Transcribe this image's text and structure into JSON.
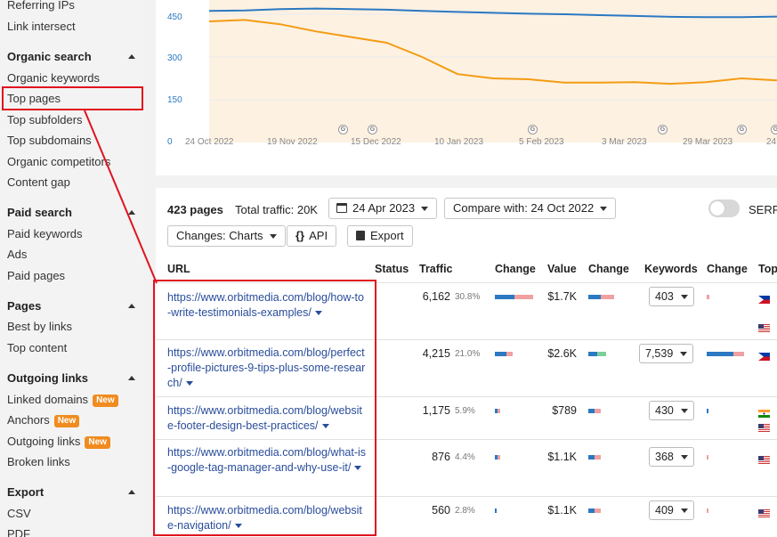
{
  "sidebar": {
    "top_items": [
      "Referring IPs",
      "Link intersect"
    ],
    "sections": [
      {
        "title": "Organic search",
        "items": [
          "Organic keywords",
          "Top pages",
          "Top subfolders",
          "Top subdomains",
          "Organic competitors",
          "Content gap"
        ]
      },
      {
        "title": "Paid search",
        "items": [
          "Paid keywords",
          "Ads",
          "Paid pages"
        ]
      },
      {
        "title": "Pages",
        "items": [
          "Best by links",
          "Top content"
        ]
      },
      {
        "title": "Outgoing links",
        "items": [
          "Linked domains",
          "Anchors",
          "Outgoing links",
          "Broken links"
        ]
      },
      {
        "title": "Export",
        "items": [
          "CSV",
          "PDF"
        ]
      }
    ],
    "new_badge": "New",
    "highlighted": "Top pages"
  },
  "chart": {
    "y_ticks": [
      "450",
      "300",
      "150",
      "0"
    ],
    "x_ticks": [
      "24 Oct 2022",
      "19 Nov 2022",
      "15 Dec 2022",
      "10 Jan 2023",
      "5 Feb 2023",
      "3 Mar 2023",
      "29 Mar 2023",
      "24"
    ],
    "marker_letter": "G",
    "series_colors": {
      "blue": "#2b79c2",
      "orange": "#f39c12",
      "band": "#fdf1e2"
    }
  },
  "chart_data": {
    "type": "line",
    "ylim": [
      0,
      500
    ],
    "series": [
      {
        "color": "#2b79c2",
        "values": [
          462,
          463,
          468,
          470,
          468,
          466,
          462,
          458,
          455,
          452,
          450,
          447,
          444,
          441,
          440,
          440,
          442
        ]
      },
      {
        "color": "#f39c12",
        "values": [
          425,
          430,
          415,
          390,
          370,
          350,
          300,
          240,
          225,
          222,
          210,
          210,
          212,
          206,
          212,
          225,
          218
        ]
      }
    ]
  },
  "table": {
    "pages_count": "423 pages",
    "total_traffic": "Total traffic: 20K",
    "date_button": "24 Apr 2023",
    "compare_button": "Compare with: 24 Oct 2022",
    "changes_button": "Changes: Charts",
    "api_button": "API",
    "export_button": "Export",
    "serp_label": "SERP",
    "headers": [
      "URL",
      "Status",
      "Traffic",
      "Change",
      "Value",
      "Change",
      "Keywords",
      "Change",
      "Top"
    ],
    "rows": [
      {
        "url": "https://www.orbitmedia.com/blog/how-to-write-testimonials-examples/",
        "traffic": "6,162",
        "pct": "30.8%",
        "value": "$1.7K",
        "keywords": "403",
        "flags": [
          "ph",
          "us"
        ]
      },
      {
        "url": "https://www.orbitmedia.com/blog/perfect-profile-pictures-9-tips-plus-some-research/",
        "traffic": "4,215",
        "pct": "21.0%",
        "value": "$2.6K",
        "keywords": "7,539",
        "flags": [
          "ph"
        ]
      },
      {
        "url": "https://www.orbitmedia.com/blog/website-footer-design-best-practices/",
        "traffic": "1,175",
        "pct": "5.9%",
        "value": "$789",
        "keywords": "430",
        "flags": [
          "in",
          "us"
        ]
      },
      {
        "url": "https://www.orbitmedia.com/blog/what-is-google-tag-manager-and-why-use-it/",
        "traffic": "876",
        "pct": "4.4%",
        "value": "$1.1K",
        "keywords": "368",
        "flags": [
          "us"
        ]
      },
      {
        "url": "https://www.orbitmedia.com/blog/website-navigation/",
        "traffic": "560",
        "pct": "2.8%",
        "value": "$1.1K",
        "keywords": "409",
        "flags": [
          "us"
        ]
      }
    ]
  }
}
